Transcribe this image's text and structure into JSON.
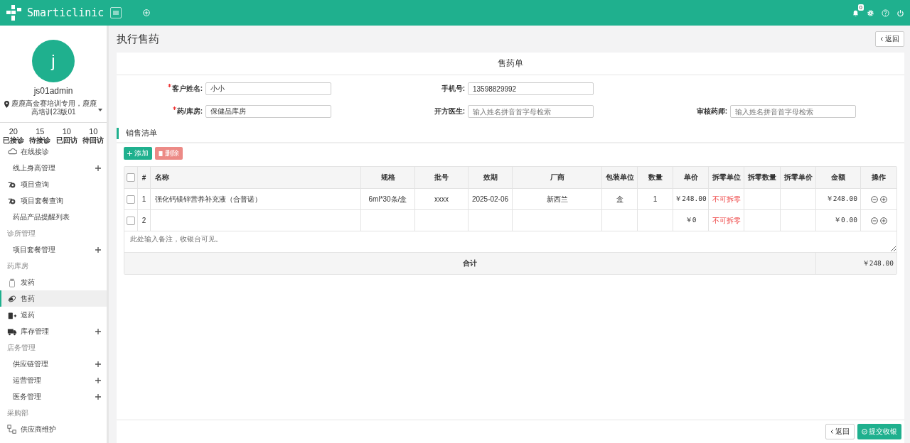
{
  "app": {
    "name": "Smarticlinic",
    "notifications": "0"
  },
  "user": {
    "initial": "j",
    "name": "js01admin",
    "location": "鹿鹿高金赛培训专用，鹿鹿高培训23版01"
  },
  "stats": [
    {
      "value": "20",
      "label": "已接诊"
    },
    {
      "value": "15",
      "label": "待接诊"
    },
    {
      "value": "10",
      "label": "已回访"
    },
    {
      "value": "10",
      "label": "待回访"
    }
  ],
  "sidebar": {
    "items": [
      {
        "kind": "icon",
        "label": "在线接诊",
        "expandable": false,
        "selected": false
      },
      {
        "kind": "sub",
        "label": "线上身高管理",
        "expandable": true,
        "selected": false
      },
      {
        "kind": "icon",
        "label": "项目查询",
        "expandable": false,
        "selected": false
      },
      {
        "kind": "icon",
        "label": "项目套餐查询",
        "expandable": false,
        "selected": false
      },
      {
        "kind": "sub",
        "label": "药品产品提醒列表",
        "expandable": false,
        "selected": false
      },
      {
        "kind": "section",
        "label": "诊所管理"
      },
      {
        "kind": "sub",
        "label": "项目套餐管理",
        "expandable": true,
        "selected": false
      },
      {
        "kind": "section",
        "label": "药库房"
      },
      {
        "kind": "icon",
        "label": "发药",
        "expandable": false,
        "selected": false
      },
      {
        "kind": "icon",
        "label": "售药",
        "expandable": false,
        "selected": true
      },
      {
        "kind": "icon",
        "label": "退药",
        "expandable": false,
        "selected": false
      },
      {
        "kind": "icon",
        "label": "库存管理",
        "expandable": true,
        "selected": false
      },
      {
        "kind": "section",
        "label": "店务管理"
      },
      {
        "kind": "sub",
        "label": "供应链管理",
        "expandable": true,
        "selected": false
      },
      {
        "kind": "sub",
        "label": "运营管理",
        "expandable": true,
        "selected": false
      },
      {
        "kind": "sub",
        "label": "医务管理",
        "expandable": true,
        "selected": false
      },
      {
        "kind": "section",
        "label": "采购部"
      },
      {
        "kind": "icon",
        "label": "供应商维护",
        "expandable": false,
        "selected": false
      }
    ]
  },
  "page": {
    "title": "执行售药",
    "back": "返回"
  },
  "form": {
    "title": "售药单",
    "fields": [
      {
        "label": "客户姓名:",
        "required": true,
        "value": "小小"
      },
      {
        "label": "手机号:",
        "required": false,
        "value": "13598829992"
      },
      {
        "label": "药/库房:",
        "required": true,
        "value": "保健品库房"
      },
      {
        "label": "开方医生:",
        "required": false,
        "placeholder": "输入姓名拼音首字母检索"
      },
      {
        "label": "审核药师:",
        "required": false,
        "placeholder": "输入姓名拼音首字母检索"
      }
    ]
  },
  "sales": {
    "title": "销售清单",
    "add": "添加",
    "delete": "删除",
    "select_all_checked": false,
    "columns": [
      "#",
      "名称",
      "规格",
      "批号",
      "效期",
      "厂商",
      "包装单位",
      "数量",
      "单价",
      "拆零单位",
      "拆零数量",
      "拆零单价",
      "金额",
      "操作"
    ],
    "rows": [
      {
        "checked": false,
        "cells": [
          "1",
          "强化钙镁锌营养补充液（合普诺）",
          "6ml*30条/盒",
          "xxxx",
          "2025-02-06",
          "新西兰",
          "盒",
          "1",
          "￥248.00",
          "不可拆零",
          "",
          "",
          "￥248.00"
        ]
      },
      {
        "checked": false,
        "cells": [
          "2",
          "",
          "",
          "",
          "",
          "",
          "",
          "",
          "￥0",
          "不可拆零",
          "",
          "",
          "￥0.00"
        ]
      }
    ],
    "note_placeholder": "此处输入备注，收银台可见。",
    "total_label": "合计",
    "total": "￥248.00"
  },
  "footer": {
    "back": "返回",
    "submit": "提交收银"
  }
}
